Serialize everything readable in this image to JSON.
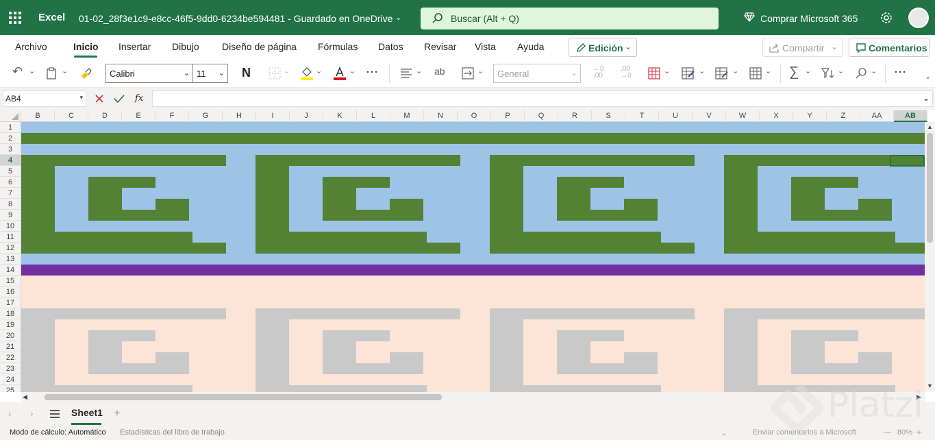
{
  "app": {
    "name": "Excel",
    "doc_title": "01-02_28f3e1c9-e8cc-46f5-9dd0-6234be594481  -  Guardado en OneDrive"
  },
  "search": {
    "placeholder": "Buscar (Alt + Q)"
  },
  "account": {
    "buy_label": "Comprar Microsoft 365"
  },
  "menu": {
    "tabs": [
      "Archivo",
      "Inicio",
      "Insertar",
      "Dibujo",
      "Diseño de página",
      "Fórmulas",
      "Datos",
      "Revisar",
      "Vista",
      "Ayuda"
    ],
    "active": "Inicio",
    "edit_label": "Edición",
    "share_label": "Compartir",
    "comments_label": "Comentarios"
  },
  "toolbar": {
    "font_name": "Calibri",
    "font_size": "11",
    "bold_label": "N",
    "number_format": "General",
    "more_label": "···"
  },
  "formula_bar": {
    "name_box": "AB4",
    "fx_label": "fx",
    "formula": ""
  },
  "grid": {
    "columns": [
      "B",
      "C",
      "D",
      "E",
      "F",
      "G",
      "H",
      "I",
      "J",
      "K",
      "L",
      "M",
      "N",
      "O",
      "P",
      "Q",
      "R",
      "S",
      "T",
      "U",
      "V",
      "W",
      "X",
      "Y",
      "Z",
      "AA",
      "AB"
    ],
    "rows": [
      "1",
      "2",
      "3",
      "4",
      "5",
      "6",
      "7",
      "8",
      "9",
      "10",
      "11",
      "12",
      "13",
      "14",
      "15",
      "16",
      "17",
      "18",
      "19",
      "20",
      "21",
      "22",
      "23",
      "24",
      "25"
    ],
    "selected_column": "AB",
    "selected_row": "4",
    "colors": {
      "sky": "#9dc3e6",
      "green": "#548235",
      "purple": "#7030a0",
      "peach": "#fce4d6",
      "gray": "#c9c9c9"
    }
  },
  "sheets": {
    "tabs": [
      "Sheet1"
    ],
    "active": "Sheet1"
  },
  "status": {
    "calc_mode": "Modo de cálculo: Automático",
    "stats": "Estadísticas del libro de trabajo",
    "feedback": "Enviar comentarios a Microsoft",
    "zoom": "80%"
  },
  "watermark": {
    "text": "Platzi"
  }
}
